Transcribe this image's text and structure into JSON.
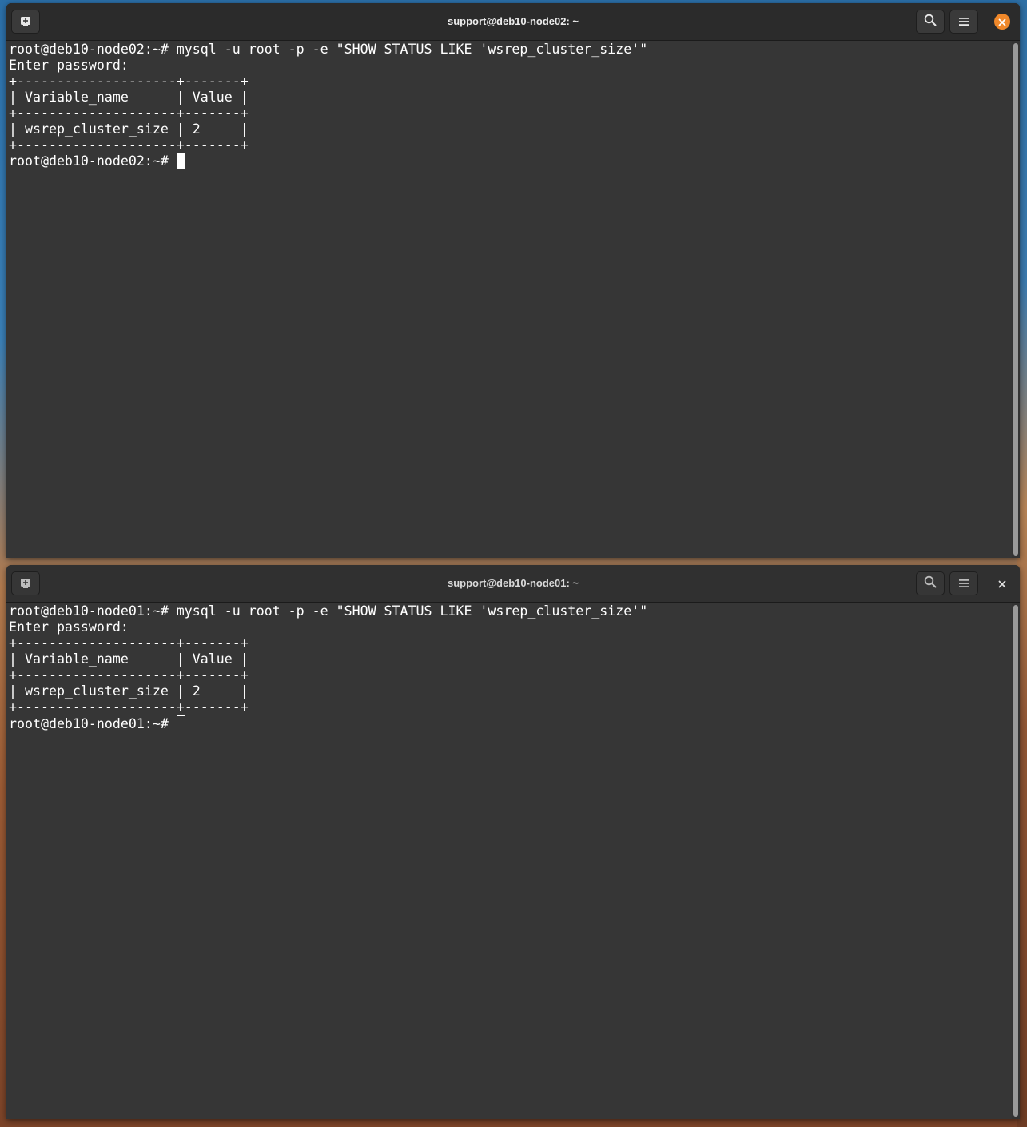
{
  "windows": [
    {
      "title": "support@deb10-node02: ~",
      "active": true,
      "icons": {
        "new_tab": "new-tab-icon",
        "search": "search-icon",
        "menu": "hamburger-menu-icon",
        "close": "close-icon"
      },
      "lines": [
        "root@deb10-node02:~# mysql -u root -p -e \"SHOW STATUS LIKE 'wsrep_cluster_size'\"",
        "Enter password:",
        "+--------------------+-------+",
        "| Variable_name      | Value |",
        "+--------------------+-------+",
        "| wsrep_cluster_size | 2     |",
        "+--------------------+-------+"
      ],
      "prompt": "root@deb10-node02:~# "
    },
    {
      "title": "support@deb10-node01: ~",
      "active": false,
      "icons": {
        "new_tab": "new-tab-icon",
        "search": "search-icon",
        "menu": "hamburger-menu-icon",
        "close": "close-icon"
      },
      "lines": [
        "root@deb10-node01:~# mysql -u root -p -e \"SHOW STATUS LIKE 'wsrep_cluster_size'\"",
        "Enter password:",
        "+--------------------+-------+",
        "| Variable_name      | Value |",
        "+--------------------+-------+",
        "| wsrep_cluster_size | 2     |",
        "+--------------------+-------+"
      ],
      "prompt": "root@deb10-node01:~# "
    }
  ],
  "colors": {
    "terminal_bg": "#363636",
    "terminal_fg": "#ffffff",
    "close_active": "#f0882a"
  }
}
